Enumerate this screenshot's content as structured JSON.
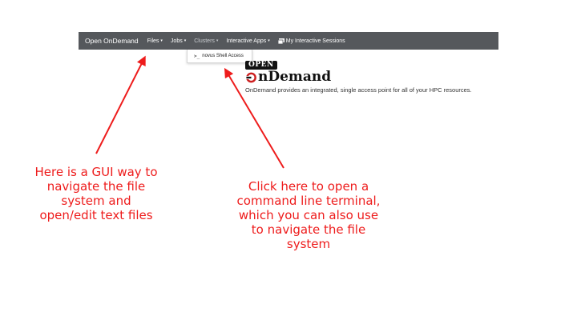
{
  "navbar": {
    "brand": "Open OnDemand",
    "items": [
      {
        "label": "Files",
        "caret": "▾"
      },
      {
        "label": "Jobs",
        "caret": "▾"
      },
      {
        "label": "Clusters",
        "caret": "▾"
      },
      {
        "label": "Interactive Apps",
        "caret": "▾"
      }
    ],
    "sessions_label": "My Interactive Sessions",
    "sessions_icon": "sessions-icon"
  },
  "clusters_dropdown": {
    "item_label": "novus Shell Access",
    "item_icon": "terminal-icon"
  },
  "logo": {
    "open_text": "OPEN",
    "ondemand_text": "nDemand",
    "accent_color": "#cc1f1f"
  },
  "tagline": "OnDemand provides an integrated, single access point for all of your HPC resources.",
  "annotations": {
    "left": [
      "Here is a GUI way to",
      "navigate the file",
      "system and",
      "open/edit text files"
    ],
    "right": [
      "Click here to open a",
      "command line terminal,",
      "which you can also use",
      "to navigate the file",
      "system"
    ],
    "color": "#ee1c1c"
  }
}
